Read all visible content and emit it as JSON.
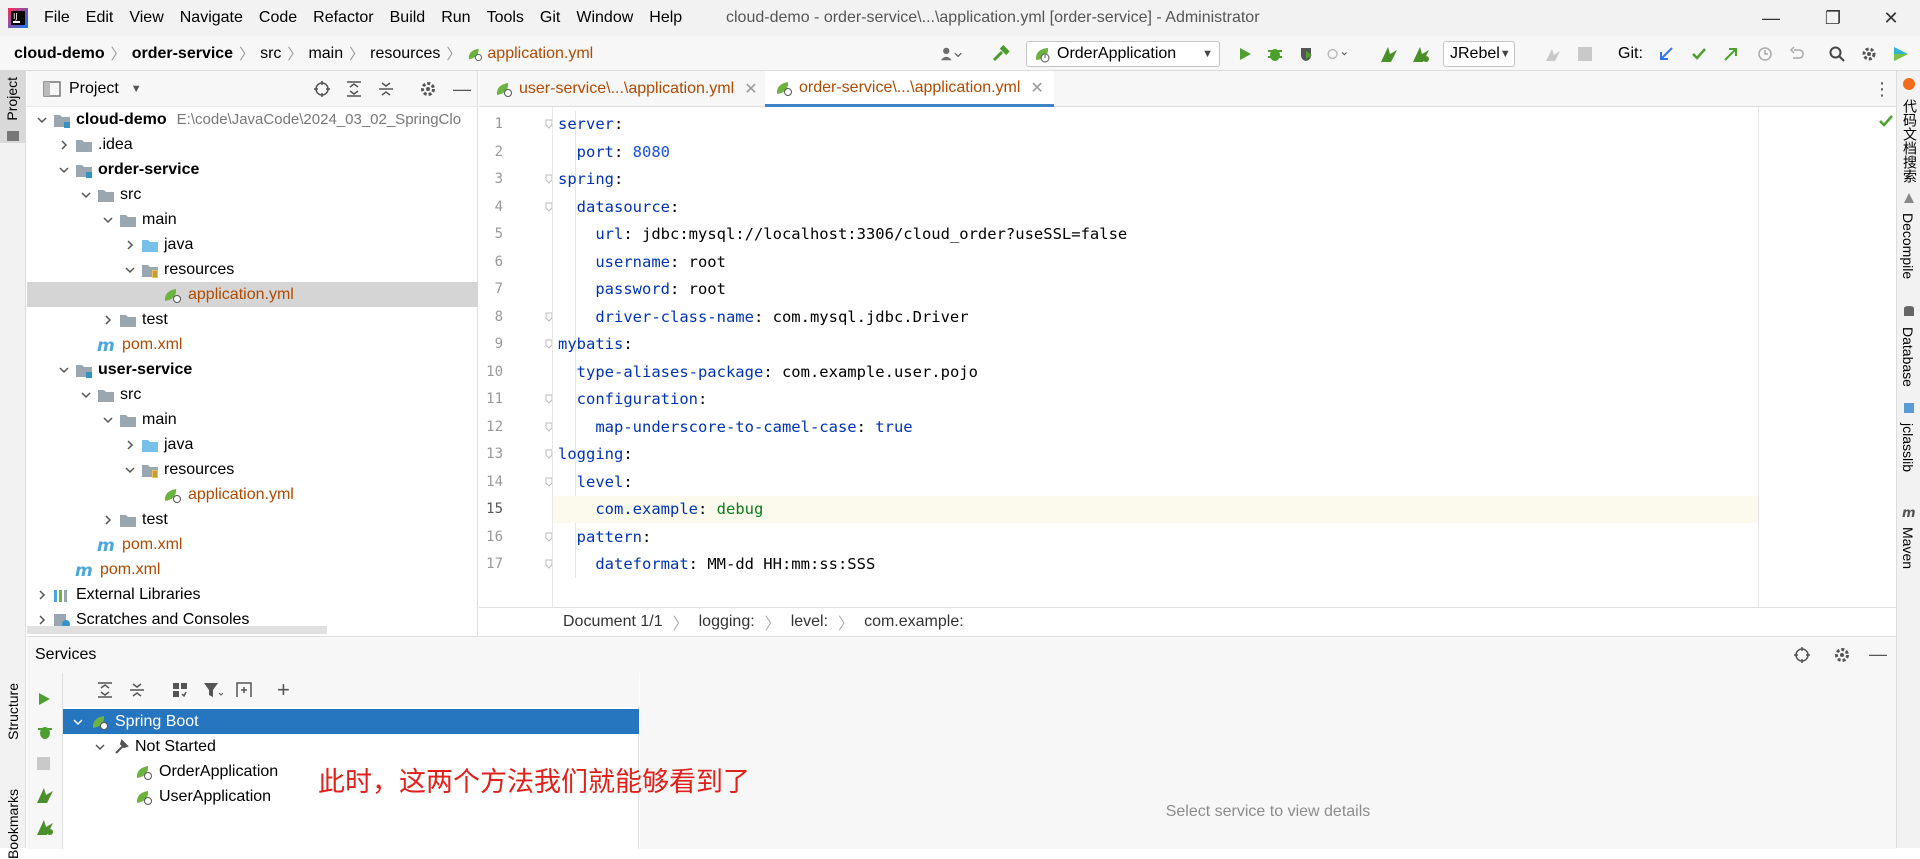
{
  "menubar": {
    "items": [
      "File",
      "Edit",
      "View",
      "Navigate",
      "Code",
      "Refactor",
      "Build",
      "Run",
      "Tools",
      "Git",
      "Window",
      "Help"
    ],
    "window_title": "cloud-demo - order-service\\...\\application.yml [order-service] - Administrator"
  },
  "navbar": {
    "crumbs": [
      "cloud-demo",
      "order-service",
      "src",
      "main",
      "resources",
      "application.yml"
    ],
    "run_config": "OrderApplication",
    "jrebel": "JRebel",
    "git_label": "Git:"
  },
  "left_strip": {
    "project": "Project",
    "structure": "Structure",
    "bookmarks": "Bookmarks"
  },
  "project": {
    "title": "Project",
    "tree": [
      {
        "label": "cloud-demo",
        "extra": "E:\\code\\JavaCode\\2024_03_02_SpringClo",
        "level": 0,
        "expanded": true,
        "kind": "module"
      },
      {
        "label": ".idea",
        "level": 1,
        "expanded": false,
        "kind": "folder"
      },
      {
        "label": "order-service",
        "level": 1,
        "expanded": true,
        "kind": "module"
      },
      {
        "label": "src",
        "level": 2,
        "expanded": true,
        "kind": "folder"
      },
      {
        "label": "main",
        "level": 3,
        "expanded": true,
        "kind": "folder"
      },
      {
        "label": "java",
        "level": 4,
        "expanded": false,
        "kind": "src"
      },
      {
        "label": "resources",
        "level": 4,
        "expanded": true,
        "kind": "res"
      },
      {
        "label": "application.yml",
        "level": 5,
        "kind": "yml",
        "selected": true
      },
      {
        "label": "test",
        "level": 3,
        "expanded": false,
        "kind": "folder"
      },
      {
        "label": "pom.xml",
        "level": 2,
        "kind": "pom"
      },
      {
        "label": "user-service",
        "level": 1,
        "expanded": true,
        "kind": "module"
      },
      {
        "label": "src",
        "level": 2,
        "expanded": true,
        "kind": "folder"
      },
      {
        "label": "main",
        "level": 3,
        "expanded": true,
        "kind": "folder"
      },
      {
        "label": "java",
        "level": 4,
        "expanded": false,
        "kind": "src"
      },
      {
        "label": "resources",
        "level": 4,
        "expanded": true,
        "kind": "res"
      },
      {
        "label": "application.yml",
        "level": 5,
        "kind": "yml"
      },
      {
        "label": "test",
        "level": 3,
        "expanded": false,
        "kind": "folder"
      },
      {
        "label": "pom.xml",
        "level": 2,
        "kind": "pom"
      },
      {
        "label": "pom.xml",
        "level": 1,
        "kind": "pom"
      },
      {
        "label": "External Libraries",
        "level": 0,
        "expanded": false,
        "kind": "lib"
      },
      {
        "label": "Scratches and Consoles",
        "level": 0,
        "expanded": false,
        "kind": "scratch"
      }
    ]
  },
  "editor": {
    "tabs": [
      {
        "label": "user-service\\...\\application.yml",
        "active": false
      },
      {
        "label": "order-service\\...\\application.yml",
        "active": true
      }
    ],
    "lines": [
      [
        {
          "t": "server",
          "c": "k"
        },
        {
          "t": ":",
          "c": "plain"
        }
      ],
      [
        {
          "t": "  port",
          "c": "k"
        },
        {
          "t": ": ",
          "c": "plain"
        },
        {
          "t": "8080",
          "c": "num"
        }
      ],
      [
        {
          "t": "spring",
          "c": "k"
        },
        {
          "t": ":",
          "c": "plain"
        }
      ],
      [
        {
          "t": "  datasource",
          "c": "k"
        },
        {
          "t": ":",
          "c": "plain"
        }
      ],
      [
        {
          "t": "    url",
          "c": "k"
        },
        {
          "t": ": jdbc:mysql://localhost:3306/cloud_order?useSSL=false",
          "c": "plain"
        }
      ],
      [
        {
          "t": "    username",
          "c": "k"
        },
        {
          "t": ": root",
          "c": "plain"
        }
      ],
      [
        {
          "t": "    password",
          "c": "k"
        },
        {
          "t": ": root",
          "c": "plain"
        }
      ],
      [
        {
          "t": "    driver-class-name",
          "c": "k"
        },
        {
          "t": ": com.mysql.jdbc.Driver",
          "c": "plain"
        }
      ],
      [
        {
          "t": "mybatis",
          "c": "k"
        },
        {
          "t": ":",
          "c": "plain"
        }
      ],
      [
        {
          "t": "  type-aliases-package",
          "c": "k"
        },
        {
          "t": ": com.example.user.pojo",
          "c": "plain"
        }
      ],
      [
        {
          "t": "  configuration",
          "c": "k"
        },
        {
          "t": ":",
          "c": "plain"
        }
      ],
      [
        {
          "t": "    map-underscore-to-camel-case",
          "c": "k"
        },
        {
          "t": ": ",
          "c": "plain"
        },
        {
          "t": "true",
          "c": "kw"
        }
      ],
      [
        {
          "t": "logging",
          "c": "k"
        },
        {
          "t": ":",
          "c": "plain"
        }
      ],
      [
        {
          "t": "  level",
          "c": "k"
        },
        {
          "t": ":",
          "c": "plain"
        }
      ],
      [
        {
          "t": "    com.example",
          "c": "k"
        },
        {
          "t": ": ",
          "c": "plain"
        },
        {
          "t": "debug",
          "c": "v"
        }
      ],
      [
        {
          "t": "  pattern",
          "c": "k"
        },
        {
          "t": ":",
          "c": "plain"
        }
      ],
      [
        {
          "t": "    dateformat",
          "c": "k"
        },
        {
          "t": ": MM-dd HH:mm:ss:SSS",
          "c": "plain"
        }
      ]
    ],
    "highlighted_line": 15,
    "breadcrumb": [
      "Document 1/1",
      "logging:",
      "level:",
      "com.example:"
    ]
  },
  "right_strip": [
    "代码文档搜索",
    "Decompile",
    "Database",
    "jclasslib",
    "Maven"
  ],
  "services": {
    "title": "Services",
    "tree": [
      {
        "label": "Spring Boot",
        "level": 0,
        "selected": true
      },
      {
        "label": "Not Started",
        "level": 1
      },
      {
        "label": "OrderApplication",
        "level": 2
      },
      {
        "label": "UserApplication",
        "level": 2
      }
    ],
    "details_hint": "Select service to view details"
  },
  "annotation": "此时，这两个方法我们就能够看到了",
  "colors": {
    "accent": "#2675bf",
    "annotation": "#e0201b",
    "keyword": "#0033b3"
  }
}
